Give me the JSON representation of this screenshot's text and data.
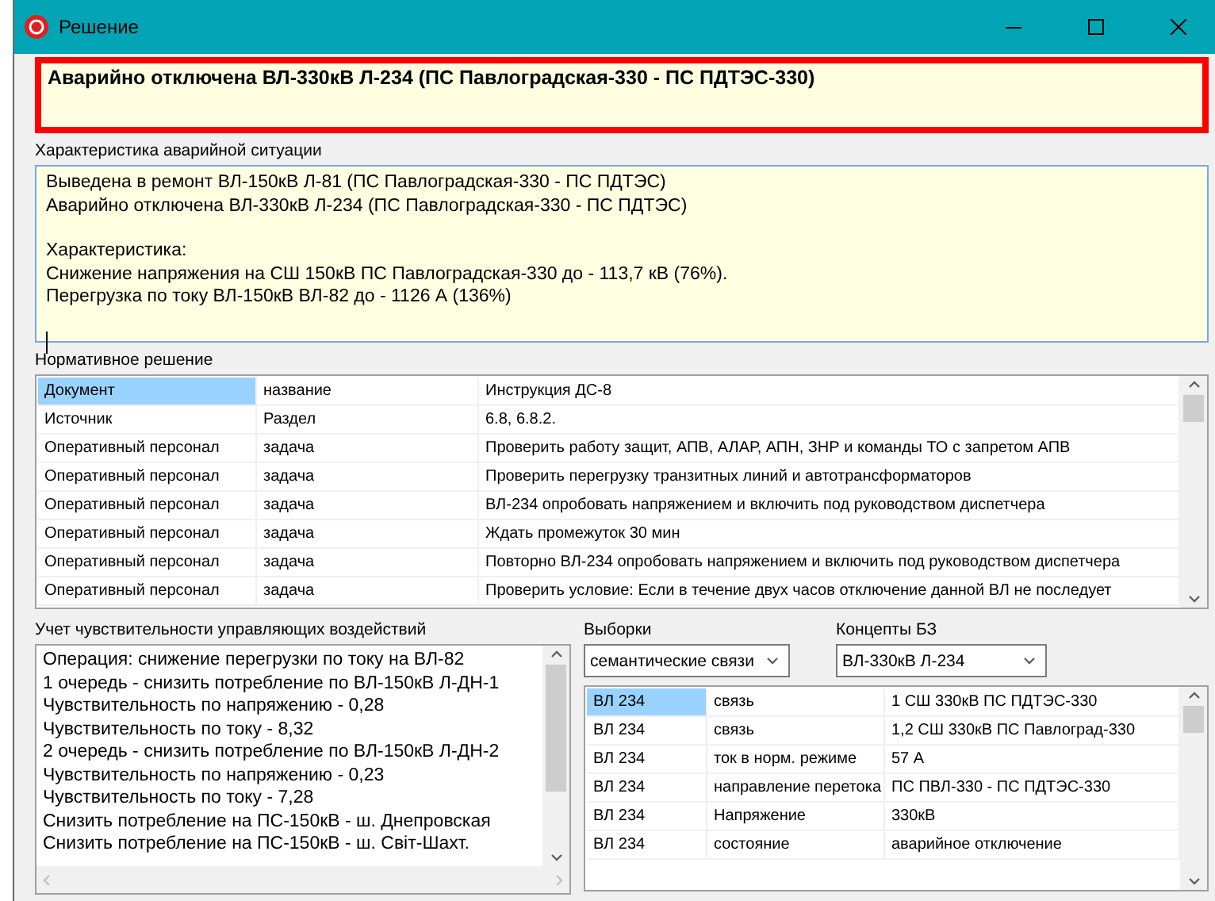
{
  "window": {
    "title": "Решение"
  },
  "headline": "Аварийно отключена ВЛ-330кВ Л-234 (ПС Павлоградская-330 - ПС ПДТЭС-330)",
  "situation": {
    "label": "Характеристика аварийной ситуации",
    "paragraphs": [
      [
        "Выведена в ремонт ВЛ-150кВ Л-81 (ПС Павлоградская-330 - ПС ПДТЭС)",
        "Аварийно отключена ВЛ-330кВ Л-234 (ПС Павлоградская-330 - ПС ПДТЭС)"
      ],
      [
        "Характеристика:",
        "Снижение напряжения на СШ 150кВ ПС Павлоградская-330 до - 113,7 кВ (76%).",
        "Перегрузка по току ВЛ-150кВ ВЛ-82 до - 1126 А (136%)"
      ]
    ]
  },
  "normative": {
    "label": "Нормативное решение",
    "rows": [
      {
        "cells": [
          "Документ",
          "название",
          "Инструкция ДС-8"
        ],
        "selected": true
      },
      {
        "cells": [
          "Источник",
          "Раздел",
          "6.8, 6.8.2."
        ],
        "selected": false
      },
      {
        "cells": [
          "Оперативный персонал",
          "задача",
          "Проверить работу защит,  АПВ, АЛАР, АПН, ЗНР и команды ТО с запретом АПВ"
        ],
        "selected": false
      },
      {
        "cells": [
          "Оперативный персонал",
          "задача",
          "Проверить перегрузку транзитных линий и автотрансформаторов"
        ],
        "selected": false
      },
      {
        "cells": [
          "Оперативный персонал",
          "задача",
          "ВЛ-234 опробовать напряжением и включить под руководством диспетчера"
        ],
        "selected": false
      },
      {
        "cells": [
          "Оперативный персонал",
          "задача",
          "Ждать промежуток 30 мин"
        ],
        "selected": false
      },
      {
        "cells": [
          "Оперативный персонал",
          "задача",
          "Повторно ВЛ-234 опробовать напряжением и включить под руководством диспетчера"
        ],
        "selected": false
      },
      {
        "cells": [
          "Оперативный персонал",
          "задача",
          "Проверить условие: Если в течение двух часов отключение данной ВЛ не последует"
        ],
        "selected": false
      }
    ]
  },
  "sensitivity": {
    "label": "Учет чувствительности управляющих воздействий",
    "lines": [
      "Операция: снижение перегрузки по току на ВЛ-82",
      "1 очередь - снизить потребление по ВЛ-150кВ Л-ДН-1",
      "Чувствительность по напряжению - 0,28",
      "Чувствительность по току - 8,32",
      "2 очередь - снизить потребление по ВЛ-150кВ Л-ДН-2",
      "Чувствительность по напряжению - 0,23",
      "Чувствительность по току - 7,28",
      "Снизить потребление на ПС-150кВ - ш. Днепровская",
      "Снизить потребление на ПС-150кВ - ш. Світ-Шахт."
    ]
  },
  "samples": {
    "label": "Выборки",
    "value": "семантические связи"
  },
  "concepts": {
    "label": "Концепты БЗ",
    "value": "ВЛ-330кВ Л-234"
  },
  "links": {
    "rows": [
      {
        "cells": [
          "ВЛ 234",
          "связь",
          "1 СШ 330кВ ПС ПДТЭС-330"
        ],
        "selected": true
      },
      {
        "cells": [
          "ВЛ 234",
          "связь",
          "1,2 СШ 330кВ ПС Павлоград-330"
        ],
        "selected": false
      },
      {
        "cells": [
          "ВЛ 234",
          "ток в норм. режиме",
          "57 А"
        ],
        "selected": false
      },
      {
        "cells": [
          "ВЛ 234",
          "направление перетока",
          "ПС ПВЛ-330 - ПС ПДТЭС-330"
        ],
        "selected": false
      },
      {
        "cells": [
          "ВЛ 234",
          "Напряжение",
          "330кВ"
        ],
        "selected": false
      },
      {
        "cells": [
          "ВЛ 234",
          "состояние",
          "аварийное отключение"
        ],
        "selected": false
      }
    ]
  }
}
